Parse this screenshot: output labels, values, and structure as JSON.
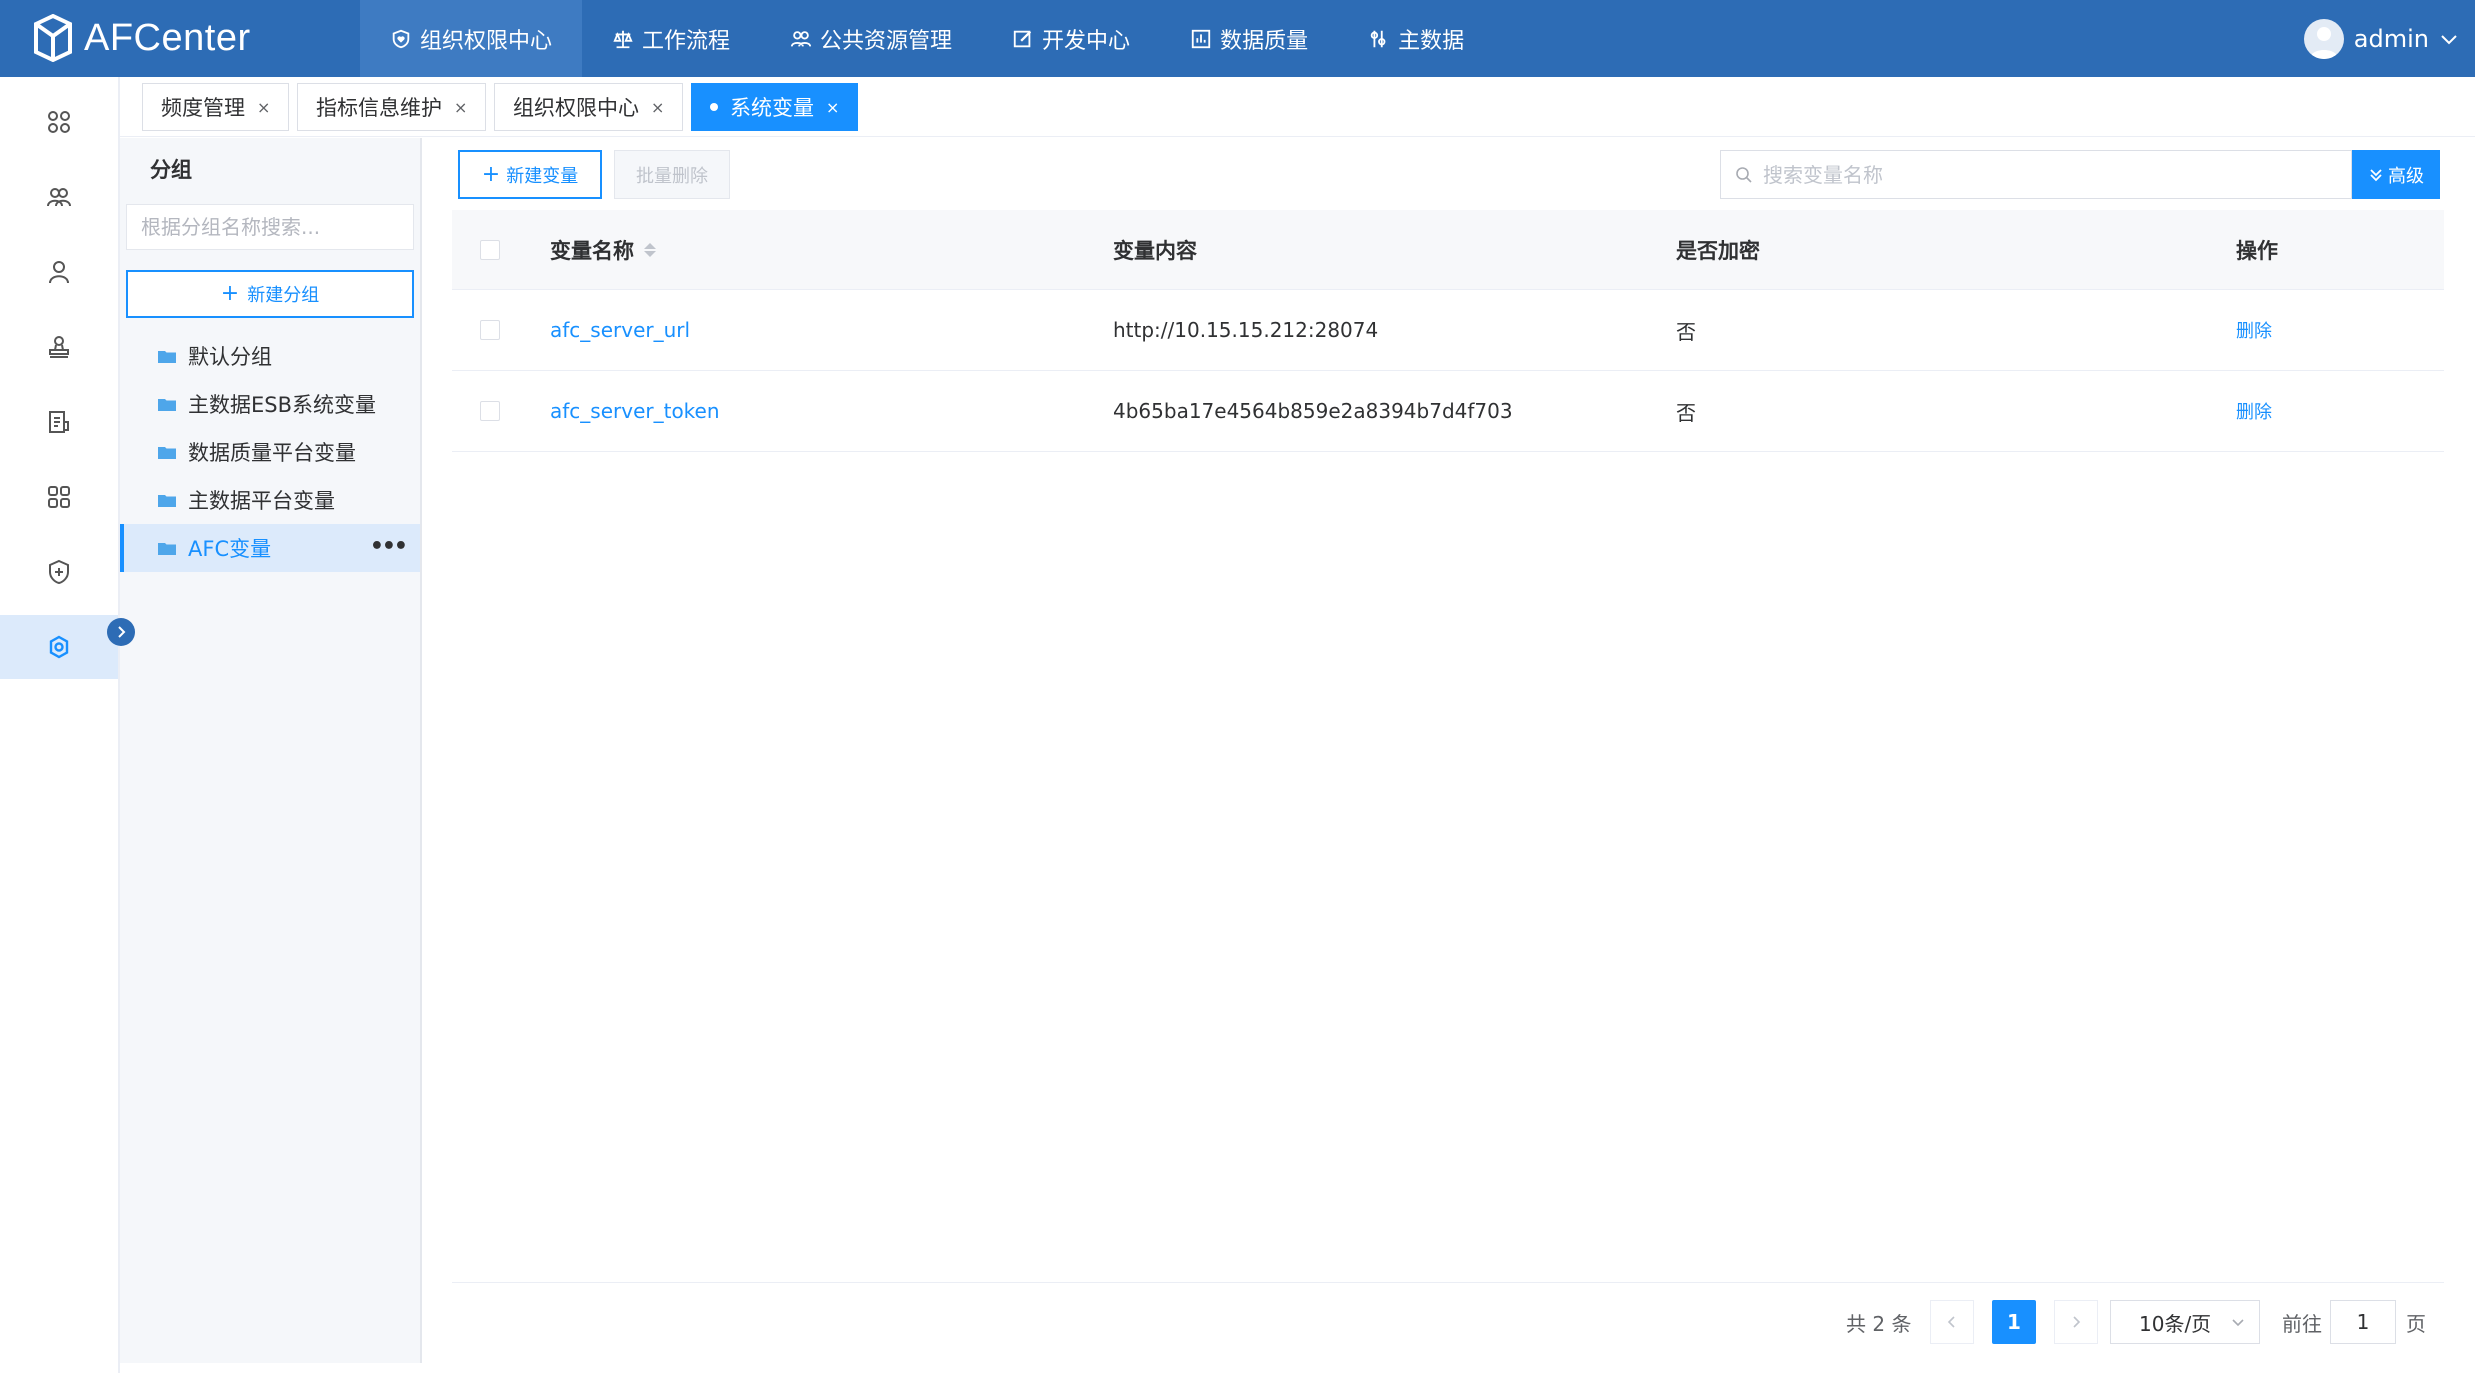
{
  "app": {
    "title": "AFCenter"
  },
  "nav": [
    {
      "label": "组织权限中心",
      "icon": "shield-heart-icon",
      "active": true
    },
    {
      "label": "工作流程",
      "icon": "scale-icon"
    },
    {
      "label": "公共资源管理",
      "icon": "users-icon"
    },
    {
      "label": "开发中心",
      "icon": "edit-icon"
    },
    {
      "label": "数据质量",
      "icon": "chart-icon"
    },
    {
      "label": "主数据",
      "icon": "tools-icon"
    }
  ],
  "user": {
    "name": "admin"
  },
  "tabs": [
    {
      "label": "频度管理",
      "close": "×"
    },
    {
      "label": "指标信息维护",
      "close": "×"
    },
    {
      "label": "组织权限中心",
      "close": "×"
    },
    {
      "label": "系统变量",
      "close": "×",
      "active": true
    }
  ],
  "groups": {
    "title": "分组",
    "search_placeholder": "根据分组名称搜索...",
    "add_label": "新建分组",
    "items": [
      {
        "label": "默认分组"
      },
      {
        "label": "主数据ESB系统变量"
      },
      {
        "label": "数据质量平台变量"
      },
      {
        "label": "主数据平台变量"
      },
      {
        "label": "AFC变量",
        "active": true
      }
    ]
  },
  "toolbar": {
    "add_label": "新建变量",
    "batch_delete_label": "批量删除",
    "search_placeholder": "搜索变量名称",
    "advanced_label": "高级"
  },
  "table": {
    "headers": {
      "name": "变量名称",
      "content": "变量内容",
      "encrypted": "是否加密",
      "ops": "操作"
    },
    "rows": [
      {
        "name": "afc_server_url",
        "content": "http://10.15.15.212:28074",
        "encrypted": "否",
        "op": "删除"
      },
      {
        "name": "afc_server_token",
        "content": "4b65ba17e4564b859e2a8394b7d4f703",
        "encrypted": "否",
        "op": "删除"
      }
    ]
  },
  "pagination": {
    "total": "共 2 条",
    "current_page": "1",
    "page_size": "10条/页",
    "jump_prefix": "前往",
    "jump_value": "1",
    "jump_suffix": "页"
  },
  "colors": {
    "header": "#2d6cb5",
    "accent": "#1890ff",
    "sidebar_active": "#dceafb"
  }
}
